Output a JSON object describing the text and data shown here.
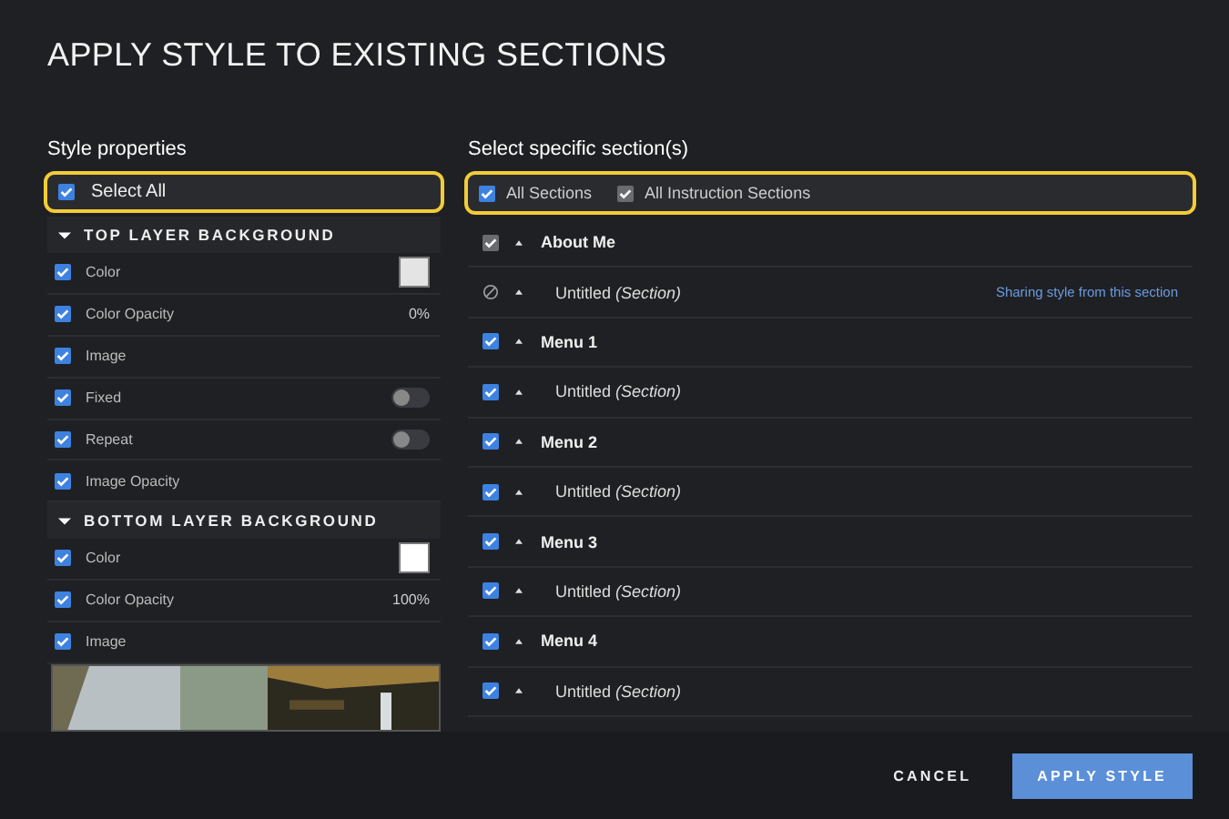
{
  "dialog": {
    "title": "APPLY STYLE TO EXISTING SECTIONS"
  },
  "style_properties": {
    "heading": "Style properties",
    "select_all": {
      "label": "Select All",
      "checked": true
    },
    "groups": [
      {
        "title": "TOP LAYER BACKGROUND",
        "expanded": true,
        "rows": [
          {
            "kind": "swatch",
            "label": "Color",
            "checked": true,
            "color": "#e4e4e4"
          },
          {
            "kind": "value",
            "label": "Color Opacity",
            "checked": true,
            "value": "0%"
          },
          {
            "kind": "plain",
            "label": "Image",
            "checked": true
          },
          {
            "kind": "toggle",
            "label": "Fixed",
            "checked": true,
            "on": false
          },
          {
            "kind": "toggle",
            "label": "Repeat",
            "checked": true,
            "on": false
          },
          {
            "kind": "plain",
            "label": "Image Opacity",
            "checked": true
          }
        ]
      },
      {
        "title": "BOTTOM LAYER BACKGROUND",
        "expanded": true,
        "rows": [
          {
            "kind": "swatch",
            "label": "Color",
            "checked": true,
            "color": "#ffffff"
          },
          {
            "kind": "value",
            "label": "Color Opacity",
            "checked": true,
            "value": "100%"
          },
          {
            "label": "Image",
            "checked": true
          }
        ]
      }
    ]
  },
  "sections": {
    "heading": "Select specific section(s)",
    "filters": [
      {
        "label": "All Sections",
        "checked": true,
        "disabled": false
      },
      {
        "label": "All Instruction Sections",
        "checked": true,
        "disabled": true
      }
    ],
    "items": [
      {
        "kind": "page",
        "label": "About Me",
        "checked": true,
        "disabled": true
      },
      {
        "kind": "source",
        "label": "Untitled *(Section)*",
        "note": "Sharing style from this section"
      },
      {
        "kind": "page",
        "label": "Menu 1",
        "checked": true,
        "disabled": false
      },
      {
        "kind": "section",
        "label": "Untitled *(Section)*",
        "checked": true,
        "disabled": false
      },
      {
        "kind": "page",
        "label": "Menu 2",
        "checked": true,
        "disabled": false
      },
      {
        "kind": "section",
        "label": "Untitled *(Section)*",
        "checked": true,
        "disabled": false
      },
      {
        "kind": "page",
        "label": "Menu 3",
        "checked": true,
        "disabled": false
      },
      {
        "kind": "section",
        "label": "Untitled *(Section)*",
        "checked": true,
        "disabled": false
      },
      {
        "kind": "page",
        "label": "Menu 4",
        "checked": true,
        "disabled": false
      },
      {
        "kind": "section",
        "label": "Untitled *(Section)*",
        "checked": true,
        "disabled": false
      }
    ]
  },
  "buttons": [
    {
      "kind": "secondary",
      "label": "CANCEL"
    },
    {
      "kind": "primary",
      "label": "APPLY STYLE"
    }
  ]
}
